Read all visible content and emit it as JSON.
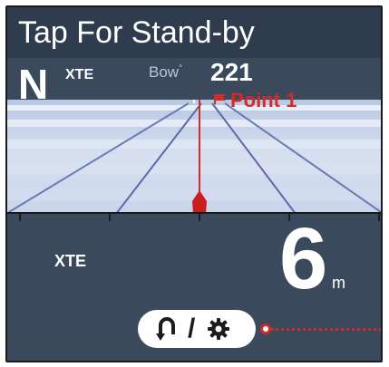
{
  "header": {
    "title": "Tap For Stand-by"
  },
  "orientation": {
    "label": "N"
  },
  "xte_small_label": "XTE",
  "bow": {
    "label": "Bow",
    "degree_mark": "°",
    "value": "221"
  },
  "waypoint": {
    "name": "Point 1",
    "icon": "flag-icon"
  },
  "xte": {
    "label": "XTE",
    "value": "6",
    "unit": "m"
  },
  "mode_button": {
    "separator": "/",
    "icons": [
      "u-turn-icon",
      "gear-icon"
    ]
  },
  "colors": {
    "background": "#3a4a5c",
    "title_bar": "#2e3c4d",
    "accent_red": "#d32a2a",
    "text": "#ffffff"
  }
}
